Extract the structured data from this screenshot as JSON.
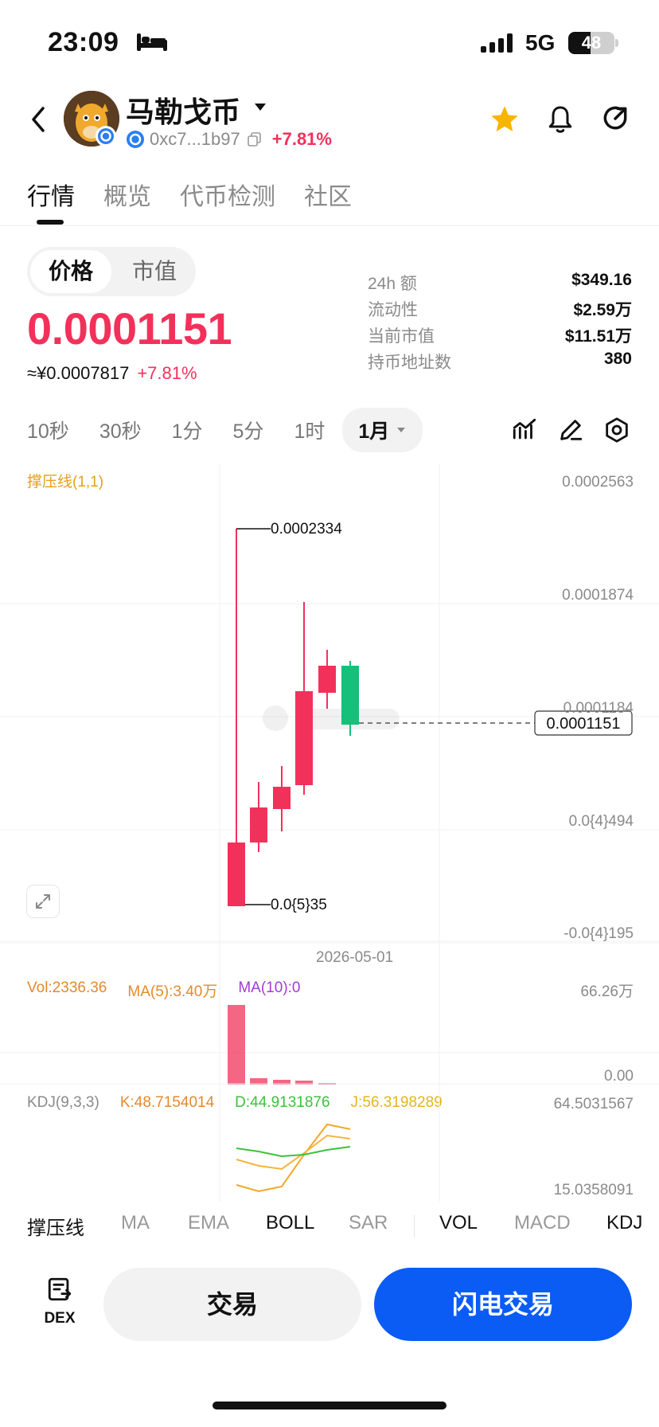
{
  "status_bar": {
    "time": "23:09",
    "network": "5G",
    "battery": "48"
  },
  "header": {
    "token_name": "马勒戈币",
    "address": "0xc7...1b97",
    "change_pct": "+7.81%",
    "icons": [
      "back-icon",
      "token-avatar",
      "chain-badge-icon",
      "copy-icon",
      "star-icon",
      "bell-icon",
      "share-icon"
    ]
  },
  "tabs": [
    {
      "label": "行情",
      "active": true
    },
    {
      "label": "概览",
      "active": false
    },
    {
      "label": "代币检测",
      "active": false
    },
    {
      "label": "社区",
      "active": false
    }
  ],
  "price_toggle": {
    "active": "价格",
    "inactive": "市值"
  },
  "price": {
    "value": "0.0001151",
    "cny": "≈¥0.0007817",
    "change": "+7.81%"
  },
  "stats": [
    {
      "label": "24h  额",
      "value": "$349.16"
    },
    {
      "label": "流动性",
      "value": "$2.59万"
    },
    {
      "label": "当前市值",
      "value": "$11.51万"
    },
    {
      "label": "持币地址数",
      "value": "380"
    }
  ],
  "timeframes": [
    "10秒",
    "30秒",
    "1分",
    "5分",
    "1时"
  ],
  "timeframe_selected": "1月",
  "chart": {
    "indicator_label": "撑压线(1,1)",
    "axis_labels": [
      "0.0002563",
      "0.0001874",
      "0.0001184",
      "0.0{4}494",
      "-0.0{4}195"
    ],
    "high_label": "0.0002334",
    "low_label": "0.0{5}35",
    "current_price_label": "0.0001151",
    "date_label": "2026-05-01",
    "colors": {
      "up": "#f2315b",
      "down": "#14c07a"
    }
  },
  "volume": {
    "vol": "Vol:2336.36",
    "ma5": "MA(5):3.40万",
    "ma10": "MA(10):0",
    "axis_top": "66.26万",
    "axis_bottom": "0.00"
  },
  "kdj": {
    "label": "KDJ(9,3,3)",
    "k": "K:48.7154014",
    "d": "D:44.9131876",
    "j": "J:56.3198289",
    "axis_top": "64.5031567",
    "axis_bottom": "15.0358091"
  },
  "indicator_tabs": [
    {
      "label": "撑压线",
      "active": true
    },
    {
      "label": "MA",
      "active": false
    },
    {
      "label": "EMA",
      "active": false
    },
    {
      "label": "BOLL",
      "active": true
    },
    {
      "label": "SAR",
      "active": false
    },
    {
      "label": "VOL",
      "active": true
    },
    {
      "label": "MACD",
      "active": false
    },
    {
      "label": "KDJ",
      "active": true
    }
  ],
  "actions": {
    "dex": "DEX",
    "trade": "交易",
    "flash_trade": "闪电交易"
  }
}
